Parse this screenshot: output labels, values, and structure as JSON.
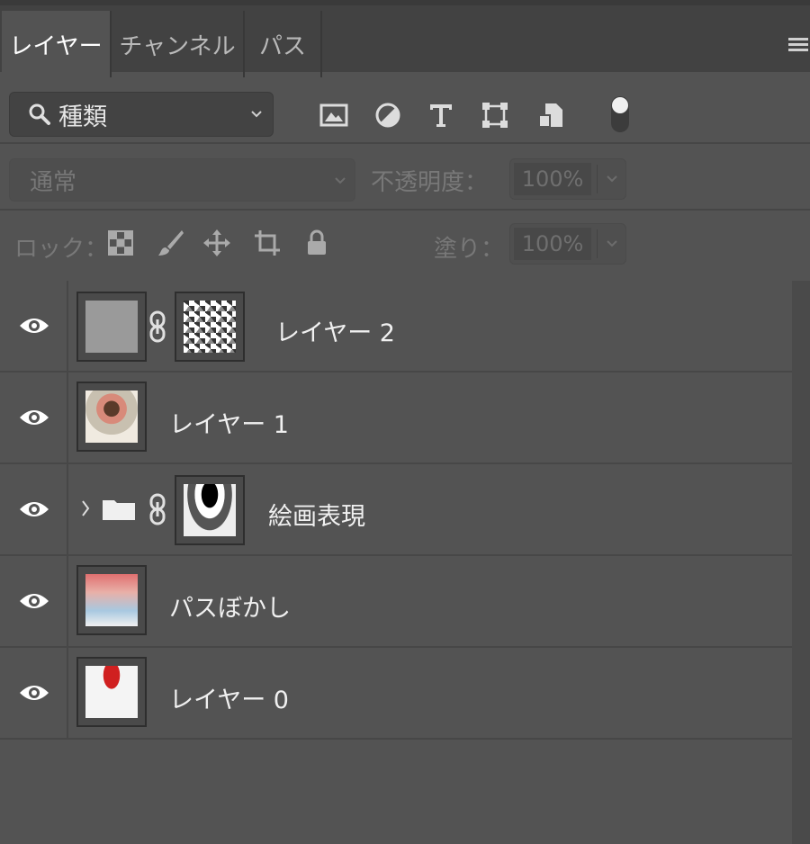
{
  "tabs": [
    {
      "label": "レイヤー",
      "active": true
    },
    {
      "label": "チャンネル",
      "active": false
    },
    {
      "label": "パス",
      "active": false
    }
  ],
  "filter": {
    "kind_label": "種類",
    "icons": [
      "image-filter-icon",
      "adjustment-filter-icon",
      "type-filter-icon",
      "shape-filter-icon",
      "smart-object-filter-icon",
      "filter-toggle-switch"
    ]
  },
  "blend": {
    "mode": "通常",
    "opacity_label": "不透明度：",
    "opacity_value": "100%"
  },
  "lock": {
    "label": "ロック：",
    "fill_label": "塗り：",
    "fill_value": "100%",
    "icons": [
      "lock-transparent-pixels-icon",
      "lock-image-pixels-icon",
      "lock-position-icon",
      "lock-artboard-icon",
      "lock-all-icon"
    ]
  },
  "layers": [
    {
      "name": "レイヤー 2",
      "visible": true,
      "has_mask": true,
      "type": "pixel"
    },
    {
      "name": "レイヤー 1",
      "visible": true,
      "has_mask": false,
      "type": "pixel"
    },
    {
      "name": "絵画表現",
      "visible": true,
      "has_mask": true,
      "type": "group"
    },
    {
      "name": "パスぼかし",
      "visible": true,
      "has_mask": false,
      "type": "pixel"
    },
    {
      "name": "レイヤー 0",
      "visible": true,
      "has_mask": false,
      "type": "pixel"
    }
  ],
  "colors": {
    "panel_bg": "#535353",
    "tabbar_bg": "#424242",
    "text": "#f0f0f0"
  }
}
